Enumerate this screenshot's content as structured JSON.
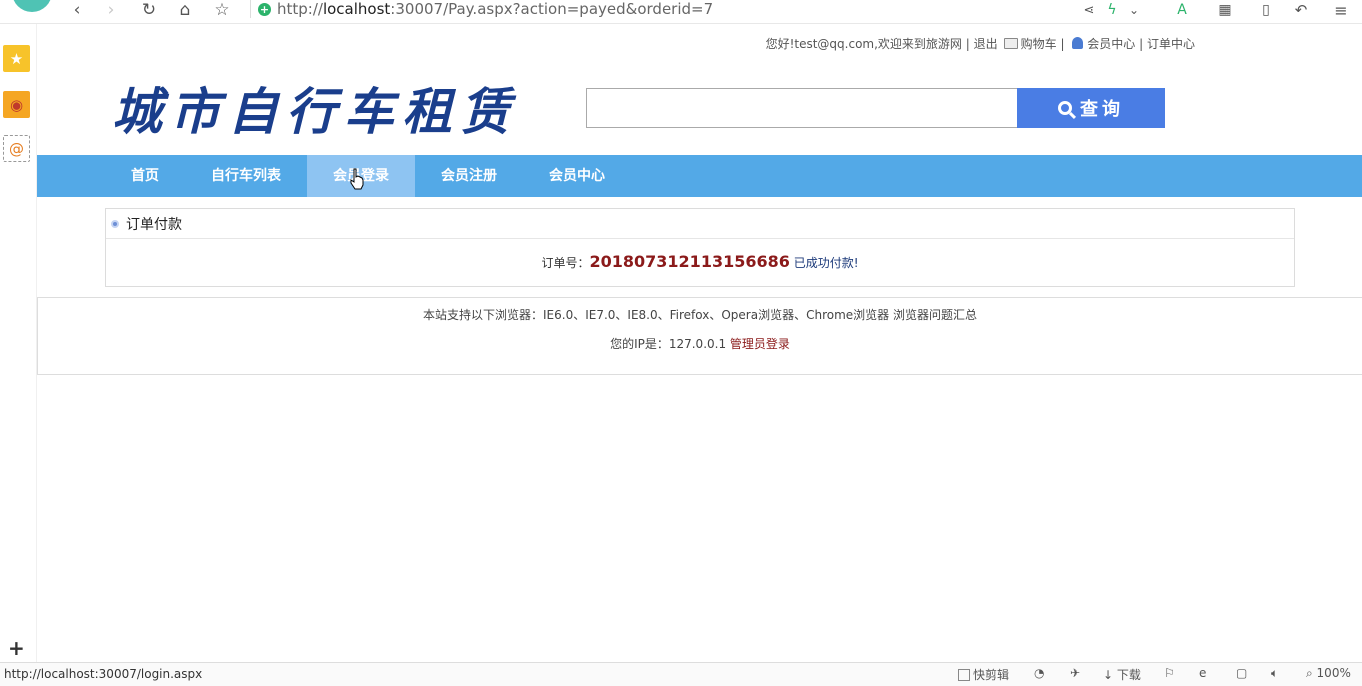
{
  "browser": {
    "url_prefix": "http://",
    "url_host": "localhost",
    "url_rest": ":30007/Pay.aspx?action=payed&orderid=7"
  },
  "top_links": {
    "greeting": "您好!test@qq.com,欢迎来到旅游网",
    "sep1": " | ",
    "logout": "退出",
    "cart": "购物车",
    "sep2": " | ",
    "member_center": "会员中心",
    "sep3": " | ",
    "order_center": "订单中心"
  },
  "logo_text": "城市自行车租赁",
  "search": {
    "placeholder": "",
    "button_label": "查询"
  },
  "nav": {
    "items": [
      {
        "label": "首页"
      },
      {
        "label": "自行车列表"
      },
      {
        "label": "会员登录"
      },
      {
        "label": "会员注册"
      },
      {
        "label": "会员中心"
      }
    ]
  },
  "order_panel": {
    "title": "订单付款",
    "order_label": "订单号：",
    "order_number": "201807312113156686",
    "status_text": "已成功付款!"
  },
  "footer": {
    "browser_support": "本站支持以下浏览器：IE6.0、IE7.0、IE8.0、Firefox、Opera浏览器、Chrome浏览器 浏览器问题汇总",
    "ip_label": "您的IP是：127.0.0.1",
    "admin_login": "管理员登录"
  },
  "status_bar": {
    "hover_url": "http://localhost:30007/login.aspx",
    "quick_clip": "快剪辑",
    "download": "下载",
    "zoom": "100%"
  }
}
